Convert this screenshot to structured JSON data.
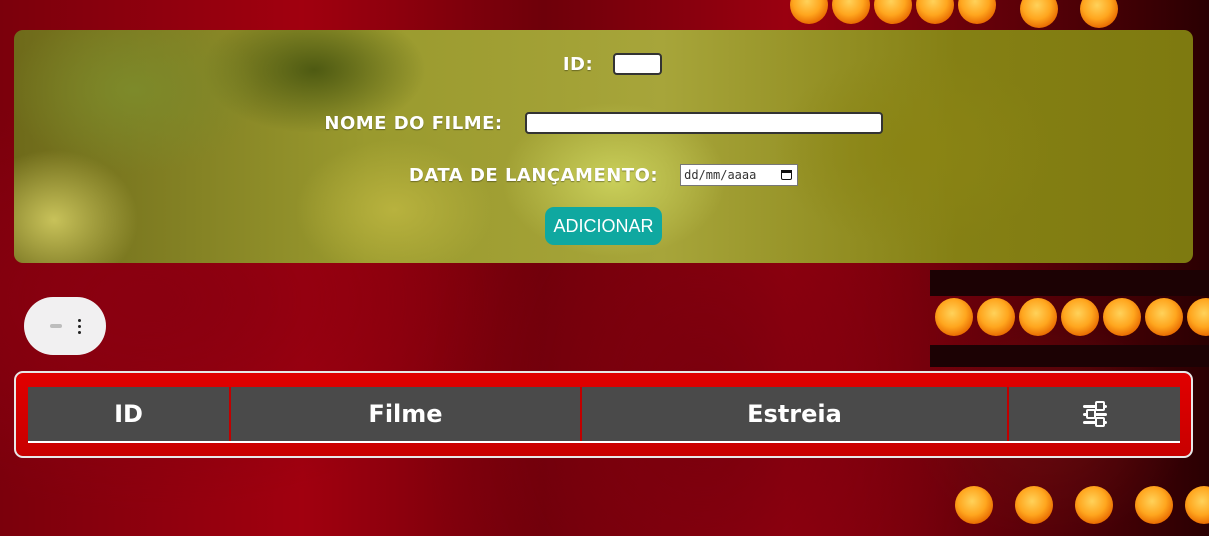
{
  "form": {
    "id_label": "ID:",
    "id_value": "",
    "name_label": "NOME DO FILME:",
    "name_value": "",
    "date_label": "DATA DE LANÇAMENTO:",
    "date_placeholder": "dd/mm/aaaa",
    "add_button": "ADICIONAR"
  },
  "toggle": {
    "icons": [
      "minus-icon",
      "kebab-icon"
    ]
  },
  "table": {
    "columns": [
      {
        "label": "ID"
      },
      {
        "label": "Filme"
      },
      {
        "label": "Estreia"
      },
      {
        "label": "",
        "icon": "sliders-icon"
      }
    ],
    "rows": []
  },
  "colors": {
    "add_button": "#0fa8a0",
    "table_frame": "#e10000",
    "table_header": "#4a4a4a",
    "form_panel": "#9a9a2e"
  }
}
